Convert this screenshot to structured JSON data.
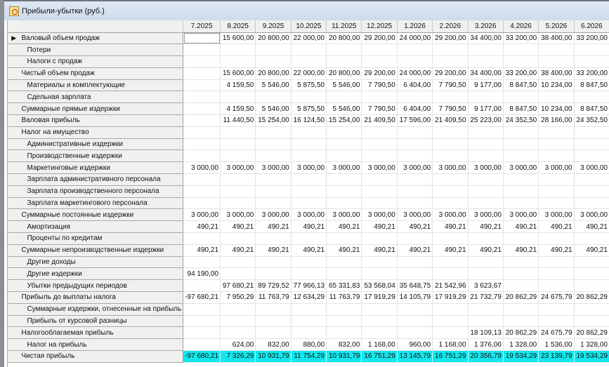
{
  "window": {
    "title": "Прибыли-убытки (руб.)",
    "icon": "report-icon"
  },
  "columns": [
    "7.2025",
    "8.2025",
    "9.2025",
    "10.2025",
    "11.2025",
    "12.2025",
    "1.2026",
    "2.2026",
    "3.2026",
    "4.2026",
    "5.2026",
    "6.2026"
  ],
  "colors": {
    "highlight": "#11e8ee"
  },
  "rows": [
    {
      "label": "Валовый объем продаж",
      "level": 0,
      "current": true,
      "values": [
        "",
        "15 600,00",
        "20 800,00",
        "22 000,00",
        "20 800,00",
        "29 200,00",
        "24 000,00",
        "29 200,00",
        "34 400,00",
        "33 200,00",
        "38 400,00",
        "33 200,00"
      ]
    },
    {
      "label": "Потери",
      "level": 1,
      "values": [
        "",
        "",
        "",
        "",
        "",
        "",
        "",
        "",
        "",
        "",
        "",
        ""
      ]
    },
    {
      "label": "Налоги с продаж",
      "level": 1,
      "values": [
        "",
        "",
        "",
        "",
        "",
        "",
        "",
        "",
        "",
        "",
        "",
        ""
      ]
    },
    {
      "label": "Чистый объем продаж",
      "level": 0,
      "values": [
        "",
        "15 600,00",
        "20 800,00",
        "22 000,00",
        "20 800,00",
        "29 200,00",
        "24 000,00",
        "29 200,00",
        "34 400,00",
        "33 200,00",
        "38 400,00",
        "33 200,00"
      ]
    },
    {
      "label": "Материалы и комплектующие",
      "level": 1,
      "values": [
        "",
        "4 159,50",
        "5 546,00",
        "5 875,50",
        "5 546,00",
        "7 790,50",
        "6 404,00",
        "7 790,50",
        "9 177,00",
        "8 847,50",
        "10 234,00",
        "8 847,50"
      ]
    },
    {
      "label": "Сдельная зарплата",
      "level": 1,
      "values": [
        "",
        "",
        "",
        "",
        "",
        "",
        "",
        "",
        "",
        "",
        "",
        ""
      ]
    },
    {
      "label": "Суммарные прямые издержки",
      "level": 0,
      "values": [
        "",
        "4 159,50",
        "5 546,00",
        "5 875,50",
        "5 546,00",
        "7 790,50",
        "6 404,00",
        "7 790,50",
        "9 177,00",
        "8 847,50",
        "10 234,00",
        "8 847,50"
      ]
    },
    {
      "label": "Валовая прибыль",
      "level": 0,
      "values": [
        "",
        "11 440,50",
        "15 254,00",
        "16 124,50",
        "15 254,00",
        "21 409,50",
        "17 596,00",
        "21 409,50",
        "25 223,00",
        "24 352,50",
        "28 166,00",
        "24 352,50"
      ]
    },
    {
      "label": "Налог на имущество",
      "level": 0,
      "values": [
        "",
        "",
        "",
        "",
        "",
        "",
        "",
        "",
        "",
        "",
        "",
        ""
      ]
    },
    {
      "label": "Административные издержки",
      "level": 1,
      "values": [
        "",
        "",
        "",
        "",
        "",
        "",
        "",
        "",
        "",
        "",
        "",
        ""
      ]
    },
    {
      "label": "Производственные издержки",
      "level": 1,
      "values": [
        "",
        "",
        "",
        "",
        "",
        "",
        "",
        "",
        "",
        "",
        "",
        ""
      ]
    },
    {
      "label": "Маркетинговые издержки",
      "level": 1,
      "values": [
        "3 000,00",
        "3 000,00",
        "3 000,00",
        "3 000,00",
        "3 000,00",
        "3 000,00",
        "3 000,00",
        "3 000,00",
        "3 000,00",
        "3 000,00",
        "3 000,00",
        "3 000,00"
      ]
    },
    {
      "label": "Зарплата административного персонала",
      "level": 1,
      "values": [
        "",
        "",
        "",
        "",
        "",
        "",
        "",
        "",
        "",
        "",
        "",
        ""
      ]
    },
    {
      "label": "Зарплата производственного персонала",
      "level": 1,
      "values": [
        "",
        "",
        "",
        "",
        "",
        "",
        "",
        "",
        "",
        "",
        "",
        ""
      ]
    },
    {
      "label": "Зарплата маркетингового персонала",
      "level": 1,
      "values": [
        "",
        "",
        "",
        "",
        "",
        "",
        "",
        "",
        "",
        "",
        "",
        ""
      ]
    },
    {
      "label": "Суммарные постоянные издержки",
      "level": 0,
      "values": [
        "3 000,00",
        "3 000,00",
        "3 000,00",
        "3 000,00",
        "3 000,00",
        "3 000,00",
        "3 000,00",
        "3 000,00",
        "3 000,00",
        "3 000,00",
        "3 000,00",
        "3 000,00"
      ]
    },
    {
      "label": "Амортизация",
      "level": 1,
      "values": [
        "490,21",
        "490,21",
        "490,21",
        "490,21",
        "490,21",
        "490,21",
        "490,21",
        "490,21",
        "490,21",
        "490,21",
        "490,21",
        "490,21"
      ]
    },
    {
      "label": "Проценты по кредитам",
      "level": 1,
      "values": [
        "",
        "",
        "",
        "",
        "",
        "",
        "",
        "",
        "",
        "",
        "",
        ""
      ]
    },
    {
      "label": "Суммарные непроизводственные издержки",
      "level": 0,
      "values": [
        "490,21",
        "490,21",
        "490,21",
        "490,21",
        "490,21",
        "490,21",
        "490,21",
        "490,21",
        "490,21",
        "490,21",
        "490,21",
        "490,21"
      ]
    },
    {
      "label": "Другие доходы",
      "level": 1,
      "values": [
        "",
        "",
        "",
        "",
        "",
        "",
        "",
        "",
        "",
        "",
        "",
        ""
      ]
    },
    {
      "label": "Другие издержки",
      "level": 1,
      "values": [
        "94 190,00",
        "",
        "",
        "",
        "",
        "",
        "",
        "",
        "",
        "",
        "",
        ""
      ]
    },
    {
      "label": "Убытки предыдущих периодов",
      "level": 1,
      "values": [
        "",
        "97 680,21",
        "89 729,52",
        "77 966,13",
        "65 331,83",
        "53 568,04",
        "35 648,75",
        "21 542,96",
        "3 623,67",
        "",
        "",
        ""
      ]
    },
    {
      "label": "Прибыль до выплаты налога",
      "level": 0,
      "values": [
        "-97 680,21",
        "7 950,29",
        "11 763,79",
        "12 634,29",
        "11 763,79",
        "17 919,29",
        "14 105,79",
        "17 919,29",
        "21 732,79",
        "20 862,29",
        "24 675,79",
        "20 862,29"
      ]
    },
    {
      "label": "Суммарные издержки, отнесенные на прибыль",
      "level": 1,
      "values": [
        "",
        "",
        "",
        "",
        "",
        "",
        "",
        "",
        "",
        "",
        "",
        ""
      ]
    },
    {
      "label": "Прибыль от курсовой разницы",
      "level": 1,
      "values": [
        "",
        "",
        "",
        "",
        "",
        "",
        "",
        "",
        "",
        "",
        "",
        ""
      ]
    },
    {
      "label": "Налогооблагаемая прибыль",
      "level": 0,
      "values": [
        "",
        "",
        "",
        "",
        "",
        "",
        "",
        "",
        "18 109,13",
        "20 862,29",
        "24 675,79",
        "20 862,29"
      ]
    },
    {
      "label": "Налог на прибыль",
      "level": 1,
      "values": [
        "",
        "624,00",
        "832,00",
        "880,00",
        "832,00",
        "1 168,00",
        "960,00",
        "1 168,00",
        "1 376,00",
        "1 328,00",
        "1 536,00",
        "1 328,00"
      ]
    },
    {
      "label": "Чистая прибыль",
      "level": 0,
      "highlight": true,
      "values": [
        "-97 680,21",
        "7 326,29",
        "10 931,79",
        "11 754,29",
        "10 931,79",
        "16 751,29",
        "13 145,79",
        "16 751,29",
        "20 356,79",
        "19 534,29",
        "23 139,79",
        "19 534,29"
      ]
    }
  ]
}
